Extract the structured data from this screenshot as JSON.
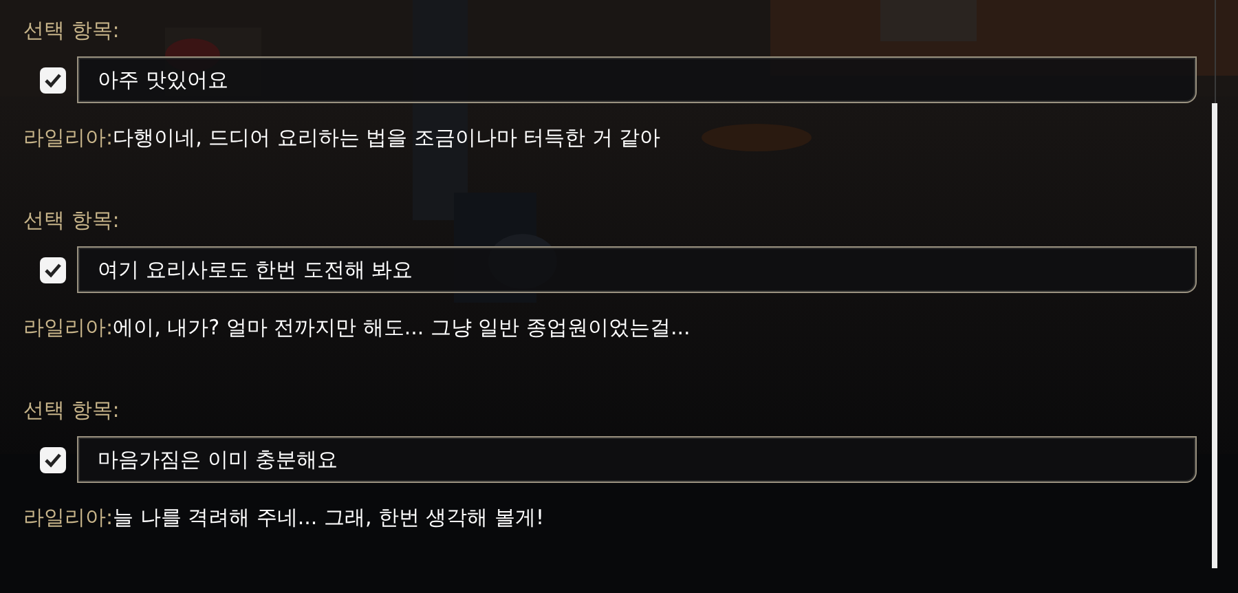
{
  "entries": [
    {
      "prompt": "선택 항목:",
      "choice": {
        "text": "아주 맛있어요",
        "checked": true
      },
      "speaker": "라일리아:",
      "line": "다행이네, 드디어 요리하는 법을 조금이나마 터득한 거 같아"
    },
    {
      "prompt": "선택 항목:",
      "choice": {
        "text": "여기 요리사로도 한번 도전해 봐요",
        "checked": true
      },
      "speaker": "라일리아:",
      "line": "에이, 내가? 얼마 전까지만 해도... 그냥 일반 종업원이었는걸..."
    },
    {
      "prompt": "선택 항목:",
      "choice": {
        "text": "마음가짐은 이미 충분해요",
        "checked": true
      },
      "speaker": "라일리아:",
      "line": "늘 나를 격려해 주네... 그래, 한번 생각해 볼게!"
    }
  ]
}
